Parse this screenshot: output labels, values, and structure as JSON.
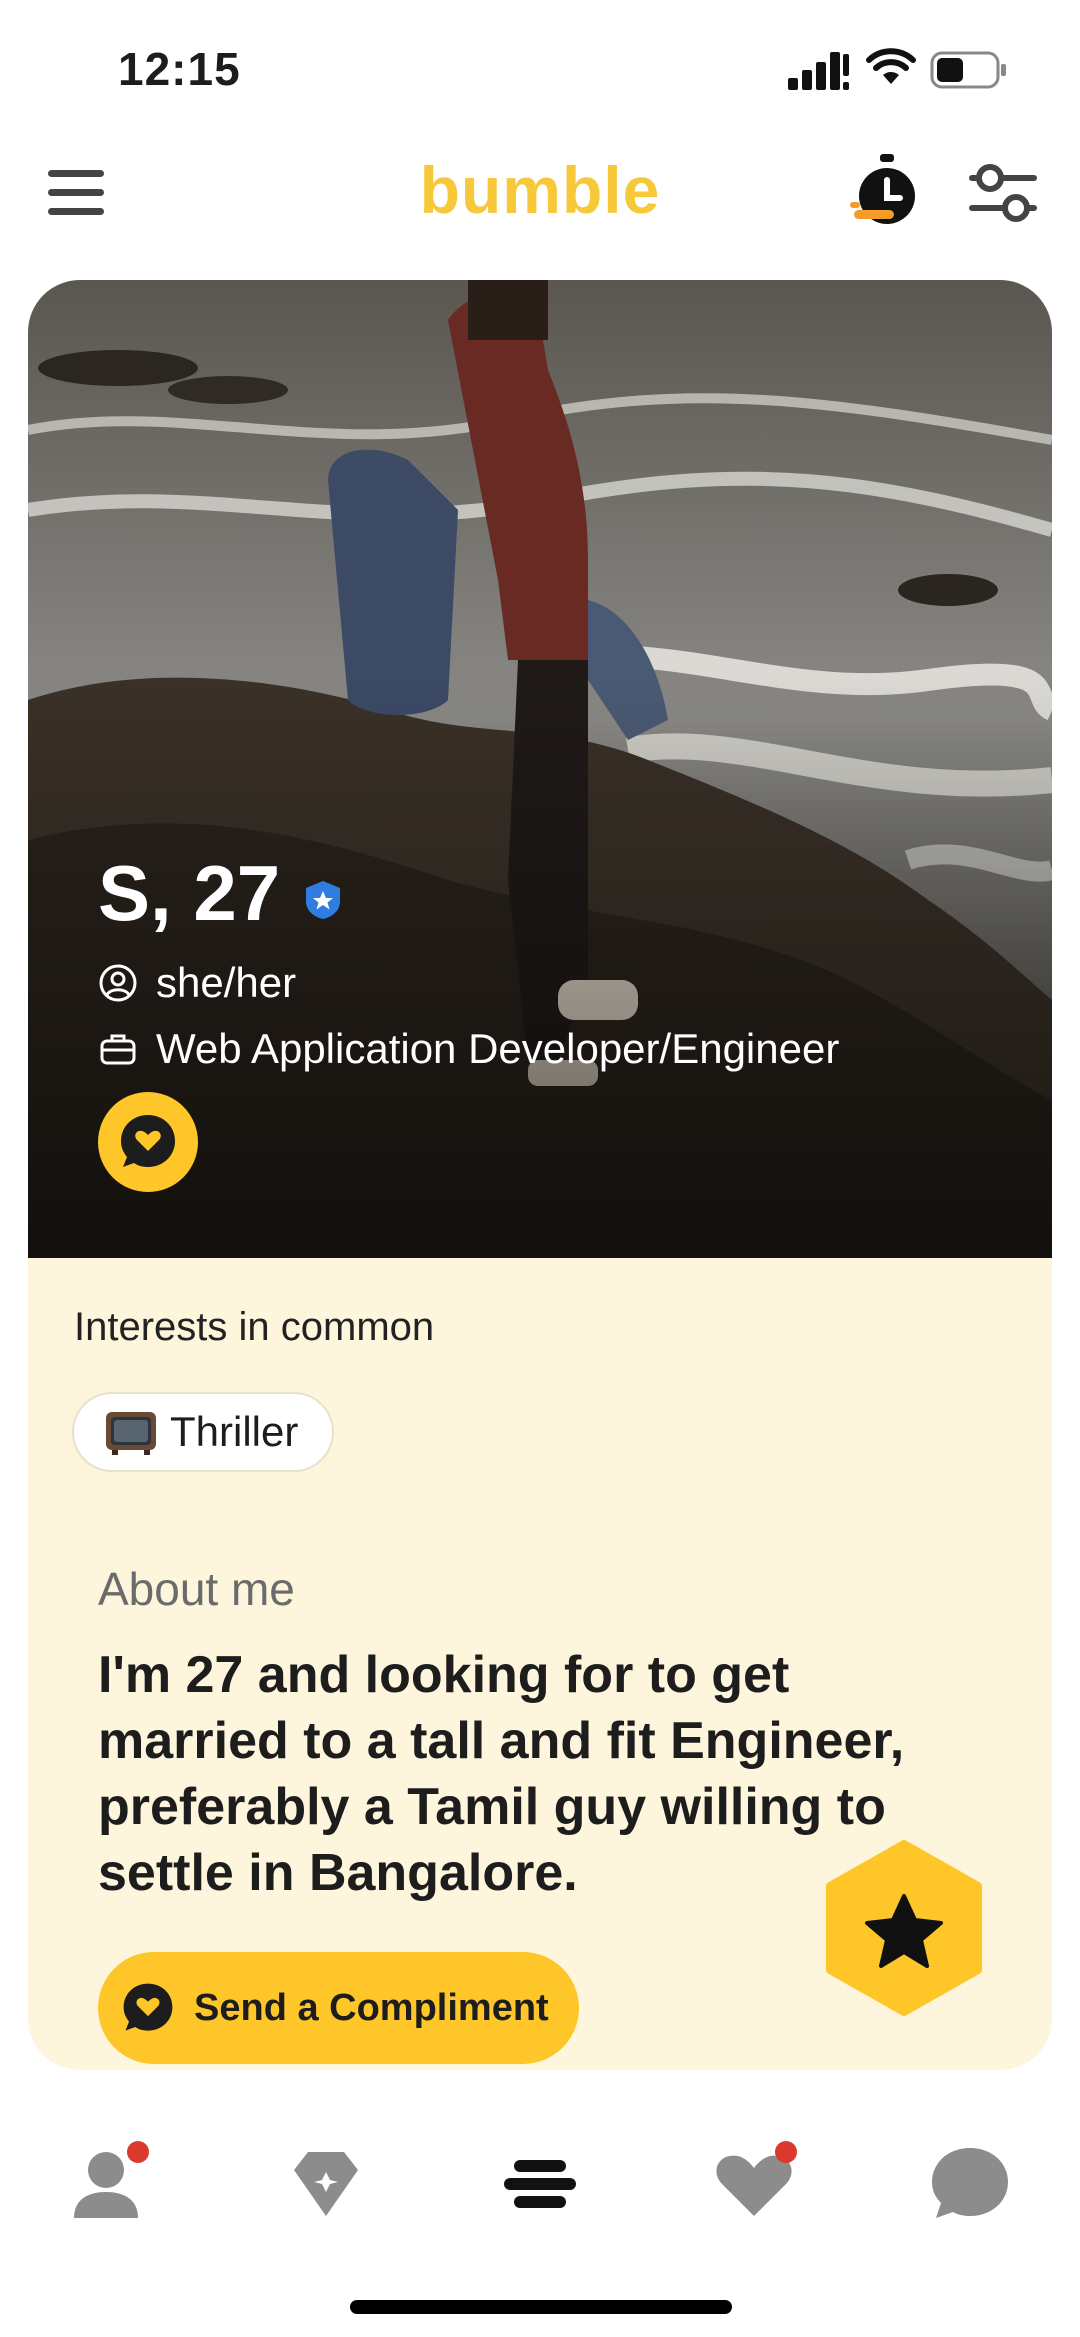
{
  "status_bar": {
    "time": "12:15"
  },
  "header": {
    "logo_text": "bumble"
  },
  "profile": {
    "name_age": "S, 27",
    "pronouns": "she/her",
    "job": "Web Application Developer/Engineer"
  },
  "interests": {
    "title": "Interests in common",
    "chips": [
      {
        "label": "Thriller",
        "icon": "tv-icon"
      }
    ]
  },
  "about": {
    "label": "About me",
    "text": "I'm 27 and looking for to get married to a tall and fit Engineer, preferably a Tamil guy willing to settle in Bangalore."
  },
  "actions": {
    "send_compliment_label": "Send a Compliment"
  },
  "bottom_nav": {
    "items": [
      {
        "name": "profile",
        "icon": "person-icon",
        "badge": true
      },
      {
        "name": "discover",
        "icon": "diamond-icon",
        "badge": false
      },
      {
        "name": "people",
        "icon": "bumble-icon",
        "badge": false,
        "active": true
      },
      {
        "name": "liked-you",
        "icon": "heart-icon",
        "badge": true
      },
      {
        "name": "chats",
        "icon": "chat-icon",
        "badge": false
      }
    ]
  },
  "colors": {
    "accent": "#ffc629",
    "logo": "#f6c83a",
    "card_bg": "#fdf5dc",
    "badge": "#d93a2b",
    "verified": "#2f7de1"
  }
}
